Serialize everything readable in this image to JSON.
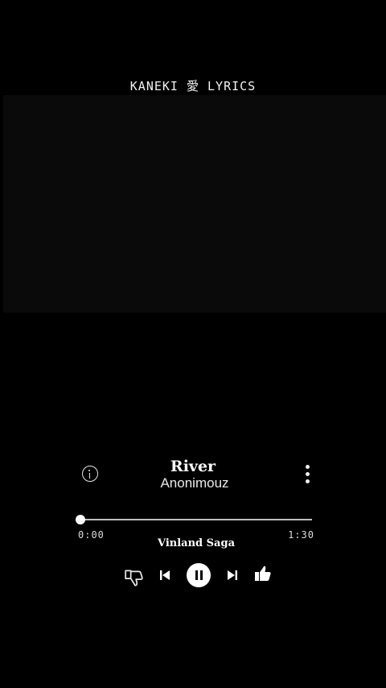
{
  "watermark": {
    "text": "KANEKI 愛 LYRICS"
  },
  "player": {
    "title": "River",
    "artist": "Anonimouz",
    "album": "Vinland Saga",
    "time_elapsed": "0:00",
    "time_total": "1:30",
    "progress": 0.0
  },
  "icons": {
    "info": "info-icon",
    "more": "more-vertical-icon",
    "dislike": "thumbs-down-icon",
    "previous": "skip-previous-icon",
    "pause": "pause-icon",
    "next": "skip-next-icon",
    "like": "thumbs-up-icon"
  },
  "colors": {
    "background": "#000000",
    "accent": "#ffffff",
    "track": "#bdbdbd"
  }
}
